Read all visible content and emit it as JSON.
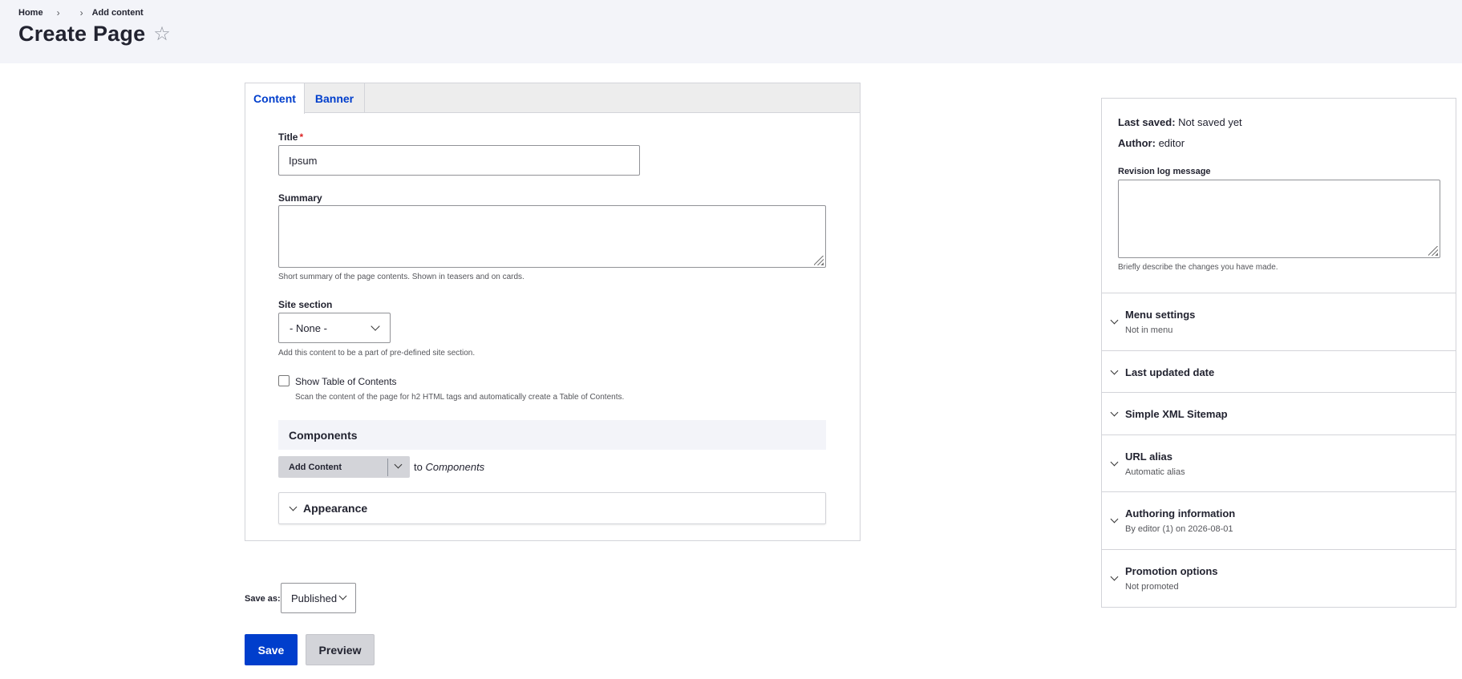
{
  "breadcrumb": {
    "home": "Home",
    "sep1": "›",
    "sep2": "›",
    "current": "Add content"
  },
  "page": {
    "title": "Create Page",
    "favorite_icon": "☆"
  },
  "tabs": [
    {
      "label": "Content"
    },
    {
      "label": "Banner"
    }
  ],
  "form": {
    "title_label": "Title",
    "required_mark": "*",
    "title_value": "Ipsum",
    "summary_label": "Summary",
    "summary_help": "Short summary of the page contents. Shown in teasers and on cards.",
    "site_section_label": "Site section",
    "site_section_value": "- None -",
    "site_section_help": "Add this content to be a part of pre-defined site section.",
    "toc_label": "Show Table of Contents",
    "toc_help": "Scan the content of the page for h2 HTML tags and automatically create a Table of Contents.",
    "components_heading": "Components",
    "add_content_label": "Add Content",
    "to_text": "to",
    "to_target": "Components",
    "appearance_label": "Appearance"
  },
  "actions": {
    "save_as_label": "Save as:",
    "save_as_value": "Published",
    "save_label": "Save",
    "preview_label": "Preview"
  },
  "sidebar": {
    "last_saved_label": "Last saved:",
    "last_saved_value": "Not saved yet",
    "author_label": "Author:",
    "author_value": "editor",
    "revision_label": "Revision log message",
    "revision_help": "Briefly describe the changes you have made.",
    "sections": [
      {
        "title": "Menu settings",
        "summary": "Not in menu"
      },
      {
        "title": "Last updated date",
        "summary": ""
      },
      {
        "title": "Simple XML Sitemap",
        "summary": ""
      },
      {
        "title": "URL alias",
        "summary": "Automatic alias"
      },
      {
        "title": "Authoring information",
        "summary": "By editor (1) on 2026-08-01"
      },
      {
        "title": "Promotion options",
        "summary": "Not promoted"
      }
    ]
  },
  "colors": {
    "accent": "#003ecc",
    "header_bg": "#f3f4f9",
    "required": "#dc2323"
  }
}
